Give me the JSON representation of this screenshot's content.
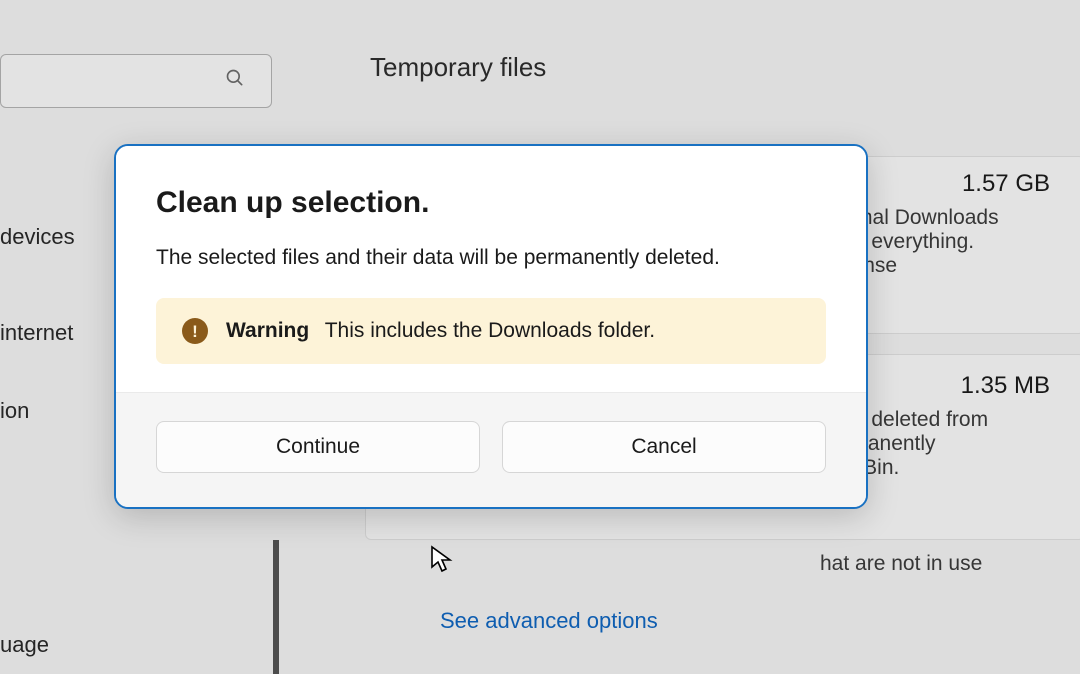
{
  "background": {
    "page_title": "Temporary files",
    "sidebar": {
      "search_placeholder": "",
      "nav": [
        "devices",
        "internet",
        "ion",
        "uage"
      ]
    },
    "items": [
      {
        "size": "1.57 GB",
        "desc_fragment": "ersonal Downloads\nelete everything.\ne Sense"
      },
      {
        "size": "1.35 MB",
        "desc_fragment": "have deleted from\npermanently\nycle Bin."
      }
    ],
    "extra_fragment": "hat are not in use",
    "link_label": "See advanced options"
  },
  "dialog": {
    "title": "Clean up selection.",
    "message": "The selected files and their data will be permanently deleted.",
    "warning_label": "Warning",
    "warning_text": "This includes the Downloads folder.",
    "continue_label": "Continue",
    "cancel_label": "Cancel"
  }
}
